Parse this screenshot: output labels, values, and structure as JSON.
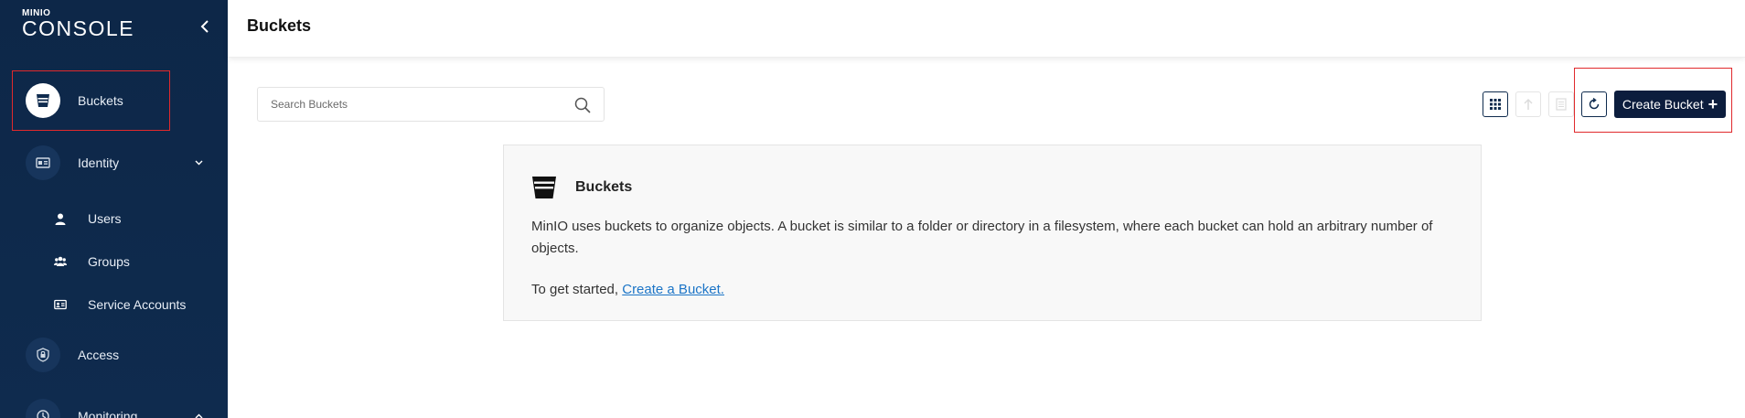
{
  "brand": {
    "top": "MINIO",
    "bottom": "CONSOLE"
  },
  "sidebar": {
    "collapse_icon": "chevron-left-icon",
    "items": [
      {
        "label": "Buckets",
        "icon": "bucket-icon",
        "active": true
      },
      {
        "label": "Identity",
        "icon": "id-card-icon",
        "expanded": true
      },
      {
        "label": "Users",
        "icon": "user-icon"
      },
      {
        "label": "Groups",
        "icon": "groups-icon"
      },
      {
        "label": "Service Accounts",
        "icon": "service-account-icon"
      },
      {
        "label": "Access",
        "icon": "lock-icon"
      },
      {
        "label": "Monitoring",
        "icon": "monitoring-icon",
        "expanded": true
      }
    ]
  },
  "header": {
    "title": "Buckets"
  },
  "search": {
    "placeholder": "Search Buckets",
    "icon": "search-icon"
  },
  "toolbar": {
    "view_icon": "grid-view-icon",
    "upload_icon": "upload-icon",
    "list_icon": "list-icon",
    "refresh_icon": "refresh-icon",
    "create_label": "Create Bucket",
    "create_icon": "plus-icon"
  },
  "info_card": {
    "title": "Buckets",
    "description": "MinIO uses buckets to organize objects. A bucket is similar to a folder or directory in a filesystem, where each bucket can hold an arbitrary number of objects.",
    "cta_prefix": "To get started, ",
    "cta_link": "Create a Bucket."
  },
  "colors": {
    "sidebar_bg": "#0f2b4e",
    "primary_button": "#0c1d3d",
    "link": "#1c75c7",
    "highlight": "#e0292c"
  }
}
